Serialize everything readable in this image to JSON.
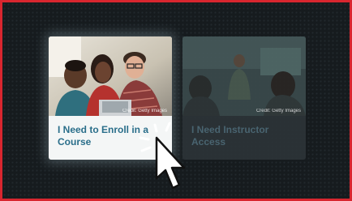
{
  "cards": [
    {
      "label": "I Need to Enroll in a Course",
      "photo_credit": "Credit: Getty Images",
      "state": "highlighted"
    },
    {
      "label": "I Need Instructor Access",
      "photo_credit": "Credit: Getty Images",
      "state": "dimmed"
    }
  ],
  "colors": {
    "frame_border": "#d8262f",
    "card_title_active": "#2a6e8a",
    "card_title_dim": "#4e6b78",
    "background": "#161b1e"
  },
  "icons": {
    "cursor": "hand-pointer-click-icon"
  }
}
